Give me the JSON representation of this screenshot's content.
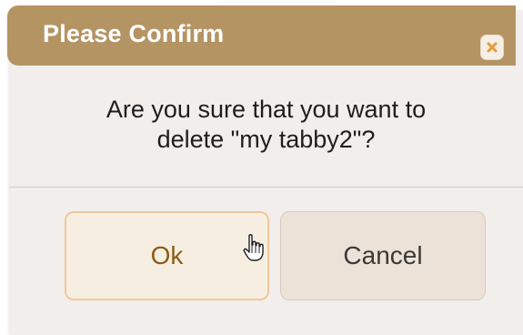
{
  "dialog": {
    "title": "Please Confirm",
    "message_line1": "Are you sure that you want to",
    "message_line2": "delete \"my tabby2\"?",
    "ok_label": "Ok",
    "cancel_label": "Cancel",
    "close_icon": "close-icon",
    "cursor_icon": "hand-pointer-cursor-icon"
  },
  "colors": {
    "titlebar": "#b59464",
    "dialog_bg": "#f1eeec",
    "ok_border": "#f0c79a",
    "ok_text": "#8c5a16",
    "close_x": "#e59a3c"
  }
}
